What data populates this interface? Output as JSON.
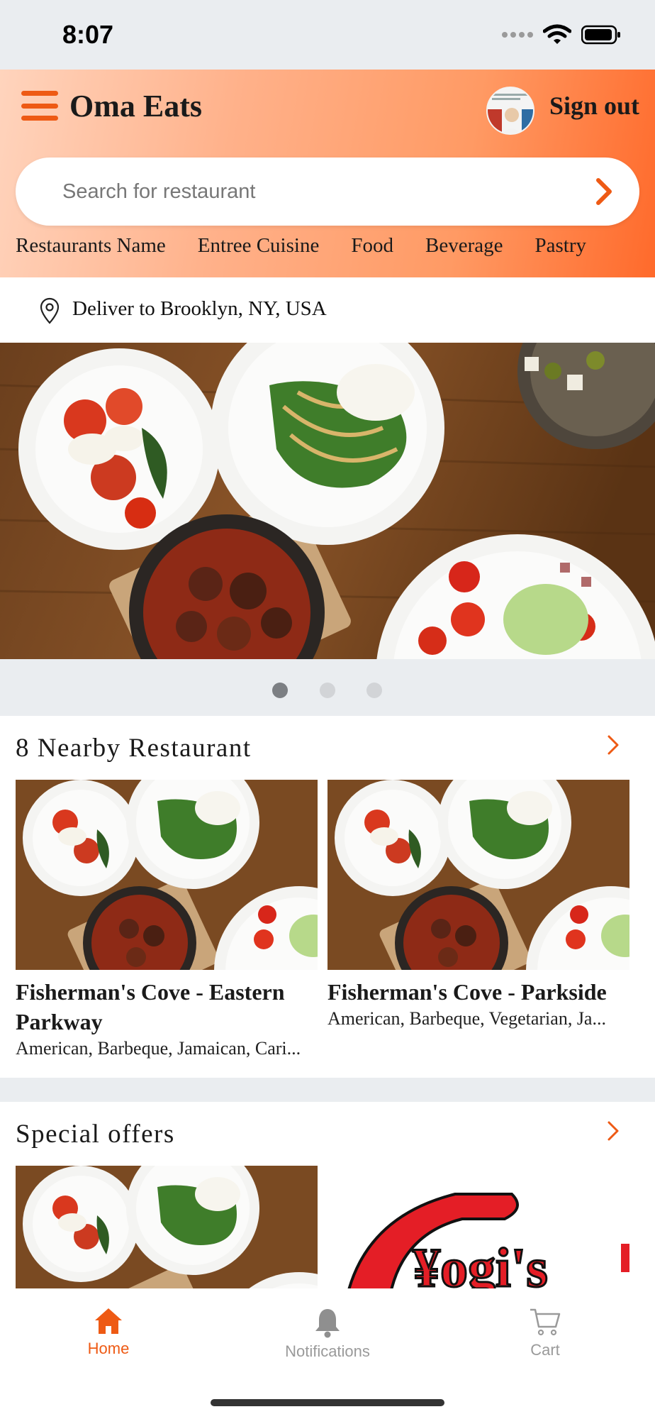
{
  "status_bar": {
    "time": "8:07"
  },
  "header": {
    "app_title": "Oma Eats",
    "sign_out_label": "Sign out",
    "search_placeholder": "Search for restaurant",
    "categories": [
      "Restaurants Name",
      "Entree Cuisine",
      "Food",
      "Beverage",
      "Pastry"
    ]
  },
  "location": {
    "text": "Deliver to Brooklyn, NY, USA"
  },
  "banner": {
    "pages": 3,
    "active_page": 1
  },
  "nearby": {
    "title": "8 Nearby Restaurant",
    "cards": [
      {
        "name": "Fisherman's Cove - Eastern Parkway",
        "cuisines": "American, Barbeque, Jamaican, Cari..."
      },
      {
        "name": "Fisherman's Cove - Parkside",
        "cuisines": "American, Barbeque, Vegetarian, Ja..."
      }
    ]
  },
  "offers": {
    "title": "Special offers",
    "logo_text": "Yogi's"
  },
  "tabbar": {
    "home": "Home",
    "notifications": "Notifications",
    "cart": "Cart"
  },
  "colors": {
    "accent": "#ee5a14",
    "background_gray": "#eaedf0"
  }
}
